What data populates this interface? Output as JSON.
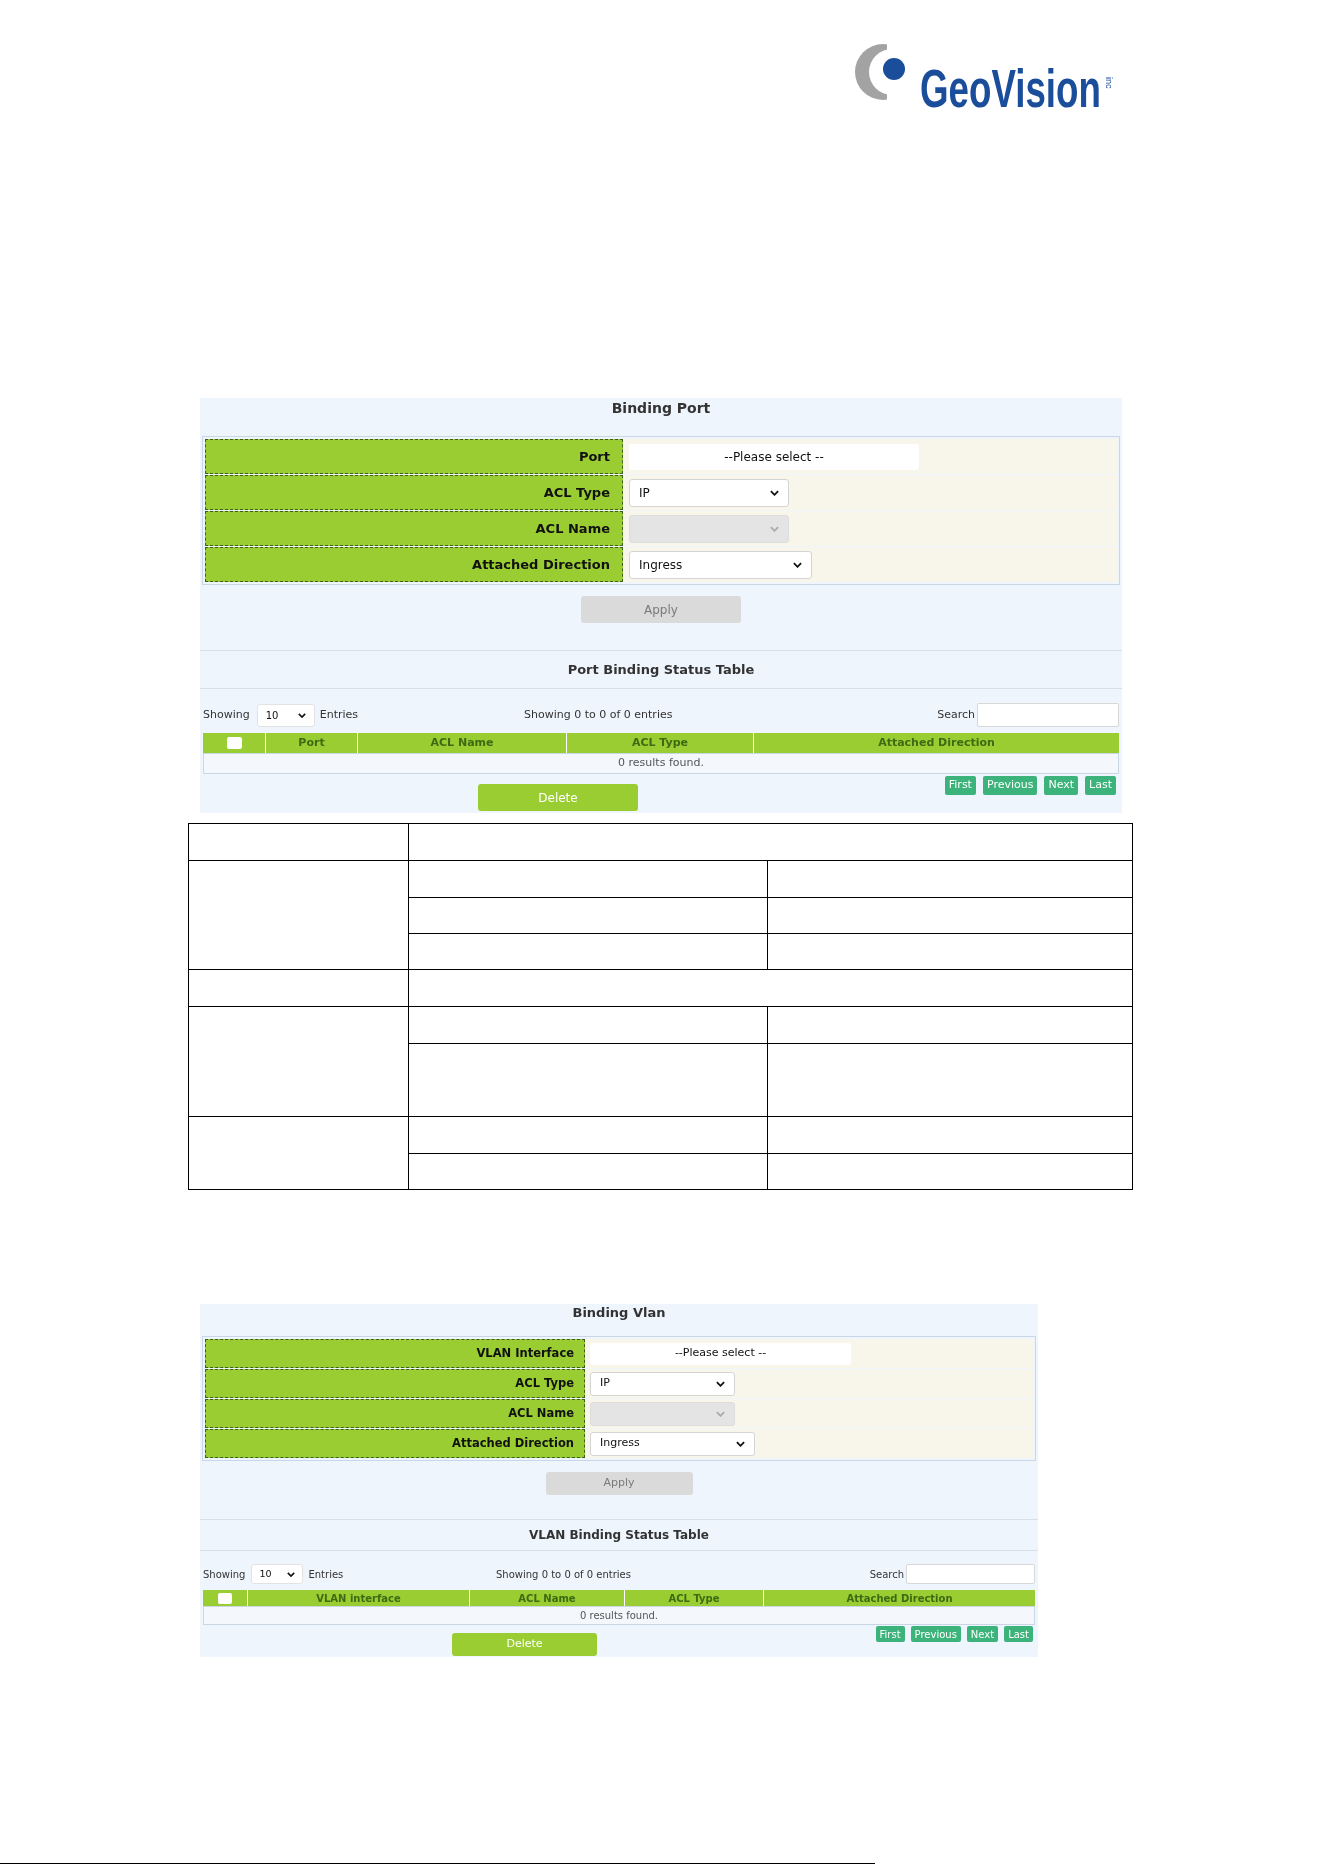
{
  "logo": {
    "name": "GeoVision",
    "suffix": "inc"
  },
  "port_binding": {
    "title": "Binding Port",
    "form": [
      {
        "label": "Port",
        "kind": "picker",
        "value": "--Please select --",
        "disabled": false
      },
      {
        "label": "ACL Type",
        "kind": "select",
        "value": "IP",
        "disabled": false
      },
      {
        "label": "ACL Name",
        "kind": "select",
        "disabled": true
      },
      {
        "label": "Attached Direction",
        "kind": "select",
        "value": "Ingress",
        "disabled": false
      }
    ],
    "apply_button": {
      "label": "Apply",
      "disabled": true
    },
    "table_title": "Port Binding Status Table",
    "page_length": {
      "before": "Showing",
      "value": "10",
      "after": "Entries"
    },
    "info": "Showing 0 to 0 of 0 entries",
    "search": {
      "label": "Search"
    },
    "columns": [
      {
        "kind": "checkbox",
        "checked": false
      },
      {
        "kind": "text",
        "label": "Port"
      },
      {
        "kind": "text",
        "label": "ACL Name"
      },
      {
        "kind": "text",
        "label": "ACL Type"
      },
      {
        "kind": "text",
        "label": "Attached Direction"
      }
    ],
    "empty_message": "0 results found.",
    "delete_button": {
      "label": "Delete",
      "disabled": false
    },
    "pagination": [
      "First",
      "Previous",
      "Next",
      "Last"
    ]
  },
  "blank_table": {
    "sections": [
      {
        "kind": "merged"
      },
      {
        "kind": "split",
        "rows": [
          {
            "kind": "normal"
          },
          {
            "kind": "normal"
          },
          {
            "kind": "normal"
          }
        ]
      },
      {
        "kind": "merged"
      },
      {
        "kind": "split",
        "rows": [
          {
            "kind": "normal"
          },
          {
            "kind": "tall"
          }
        ]
      },
      {
        "kind": "split",
        "rows": [
          {
            "kind": "normal"
          },
          {
            "kind": "normal"
          }
        ]
      }
    ]
  },
  "vlan_binding": {
    "title": "Binding Vlan",
    "form": [
      {
        "label": "VLAN Interface",
        "kind": "picker",
        "value": "--Please select --",
        "disabled": false
      },
      {
        "label": "ACL Type",
        "kind": "select",
        "value": "IP",
        "disabled": false
      },
      {
        "label": "ACL Name",
        "kind": "select",
        "disabled": true
      },
      {
        "label": "Attached Direction",
        "kind": "select",
        "value": "Ingress",
        "disabled": false
      }
    ],
    "apply_button": {
      "label": "Apply",
      "disabled": true
    },
    "table_title": "VLAN Binding Status Table",
    "page_length": {
      "before": "Showing",
      "value": "10",
      "after": "Entries"
    },
    "info": "Showing 0 to 0 of 0 entries",
    "search": {
      "label": "Search"
    },
    "columns": [
      {
        "kind": "checkbox",
        "checked": false
      },
      {
        "kind": "text",
        "label": "VLAN interface"
      },
      {
        "kind": "text",
        "label": "ACL Name"
      },
      {
        "kind": "text",
        "label": "ACL Type"
      },
      {
        "kind": "text",
        "label": "Attached Direction"
      }
    ],
    "empty_message": "0 results found.",
    "delete_button": {
      "label": "Delete",
      "disabled": false
    },
    "pagination": [
      "First",
      "Previous",
      "Next",
      "Last"
    ]
  }
}
